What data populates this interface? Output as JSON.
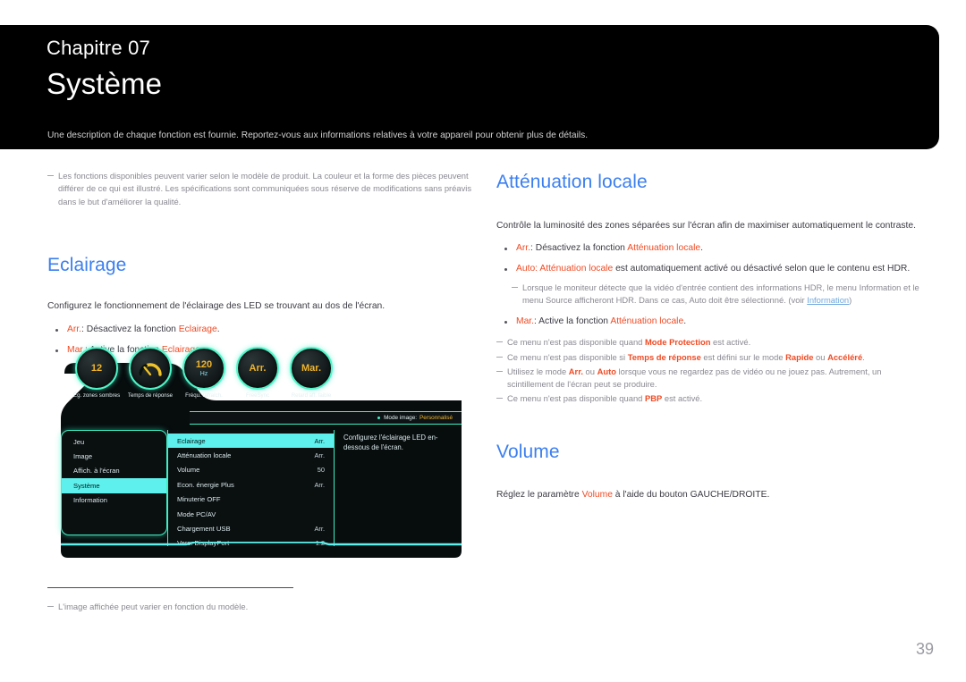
{
  "header": {
    "chapter": "Chapitre 07",
    "title": "Système",
    "description": "Une description de chaque fonction est fournie. Reportez-vous aux informations relatives à votre appareil pour obtenir plus de détails."
  },
  "colors": {
    "heading_blue": "#3b7fef",
    "highlight_orange": "#f04a23",
    "link_blue": "#6fa8dc",
    "osd_cyan": "#3ef0c4",
    "osd_selected": "#5ef0ec",
    "osd_amber": "#f0b429",
    "banner_black": "#000000"
  },
  "left_column": {
    "intro_note": "Les fonctions disponibles peuvent varier selon le modèle de produit. La couleur et la forme des pièces peuvent différer de ce qui est illustré. Les spécifications sont communiquées sous réserve de modifications sans préavis dans le but d'améliorer la qualité.",
    "section": {
      "heading": "Eclairage",
      "intro": "Configurez le fonctionnement de l'éclairage des LED se trouvant au dos de l'écran.",
      "bullets": [
        {
          "term": "Arr.",
          "before": ": Désactivez la fonction ",
          "link": "Eclairage",
          "after": "."
        },
        {
          "term": "Mar.",
          "before": ": Active la fonction ",
          "link": "Eclairage",
          "after": "."
        }
      ]
    },
    "figure_note": "L'image affichée peut varier en fonction du modèle."
  },
  "osd": {
    "icons": [
      {
        "value": "12",
        "unit": "",
        "caption": "Ég. zones sombres",
        "glyph": "value"
      },
      {
        "value": "",
        "unit": "",
        "caption": "Temps de réponse",
        "glyph": "gauge"
      },
      {
        "value": "120",
        "unit": "Hz",
        "caption": "Fréqu. rafraîch.",
        "glyph": "value"
      },
      {
        "value": "Arr.",
        "unit": "",
        "caption": "FreeSync",
        "glyph": "value"
      },
      {
        "value": "Mar.",
        "unit": "",
        "caption": "Retard aff. faible",
        "glyph": "value"
      }
    ],
    "mode_bar": {
      "label": "Mode image:",
      "value": "Personnalisé"
    },
    "left_menu": [
      {
        "label": "Jeu",
        "selected": false
      },
      {
        "label": "Image",
        "selected": false
      },
      {
        "label": "Affich. à l'écran",
        "selected": false
      },
      {
        "label": "Système",
        "selected": true
      },
      {
        "label": "Information",
        "selected": false
      }
    ],
    "middle_menu": [
      {
        "label": "Eclairage",
        "value": "Arr.",
        "selected": true
      },
      {
        "label": "Atténuation locale",
        "value": "Arr.",
        "selected": false
      },
      {
        "label": "Volume",
        "value": "50",
        "selected": false
      },
      {
        "label": "Econ. énergie Plus",
        "value": "Arr.",
        "selected": false
      },
      {
        "label": "Minuterie OFF",
        "value": "",
        "selected": false
      },
      {
        "label": "Mode PC/AV",
        "value": "",
        "selected": false
      },
      {
        "label": "Chargement USB",
        "value": "Arr.",
        "selected": false
      },
      {
        "label": "Vers. DisplayPort",
        "value": "1.2",
        "selected": false
      }
    ],
    "description": "Configurez l'éclairage LED en-dessous de l'écran."
  },
  "right_column": {
    "section_dimming": {
      "heading": "Atténuation locale",
      "intro": "Contrôle la luminosité des zones séparées sur l'écran afin de maximiser automatiquement le contraste.",
      "bullet_arr": {
        "term": "Arr.",
        "before": ": Désactivez la fonction ",
        "link": "Atténuation locale",
        "after": "."
      },
      "bullet_auto": {
        "term": "Auto:",
        "link": " Atténuation locale",
        "after": " est automatiquement activé ou désactivé selon que le contenu est HDR."
      },
      "sub_note_part1": "Lorsque le moniteur détecte que la vidéo d'entrée contient des informations HDR, le menu Information et le menu Source afficheront HDR. Dans ce cas, Auto doit être sélectionné. (voir ",
      "sub_note_link": "Information",
      "sub_note_part2": ")",
      "bullet_mar": {
        "term": "Mar.",
        "before": ": Active la fonction ",
        "link": "Atténuation locale",
        "after": "."
      },
      "notes": [
        {
          "pre": "Ce menu n'est pas disponible quand ",
          "strong": "Mode Protection",
          "post": " est activé."
        },
        {
          "pre": "Ce menu n'est pas disponible si ",
          "strong": "Temps de réponse",
          "mid": " est défini sur le mode ",
          "strong2": "Rapide",
          "mid2": " ou ",
          "strong3": "Accéléré",
          "post": "."
        },
        {
          "pre": "Utilisez le mode ",
          "strong": "Arr.",
          "mid": " ou ",
          "strong2": "Auto",
          "post": " lorsque vous ne regardez pas de vidéo ou ne jouez pas. Autrement, un scintillement de l'écran peut se produire."
        },
        {
          "pre": "Ce menu n'est pas disponible quand ",
          "strong": "PBP",
          "post": " est activé."
        }
      ]
    },
    "section_volume": {
      "heading": "Volume",
      "body_pre": "Réglez le paramètre ",
      "body_hl": "Volume",
      "body_post": " à l'aide du bouton GAUCHE/DROITE."
    }
  },
  "page_number": "39"
}
